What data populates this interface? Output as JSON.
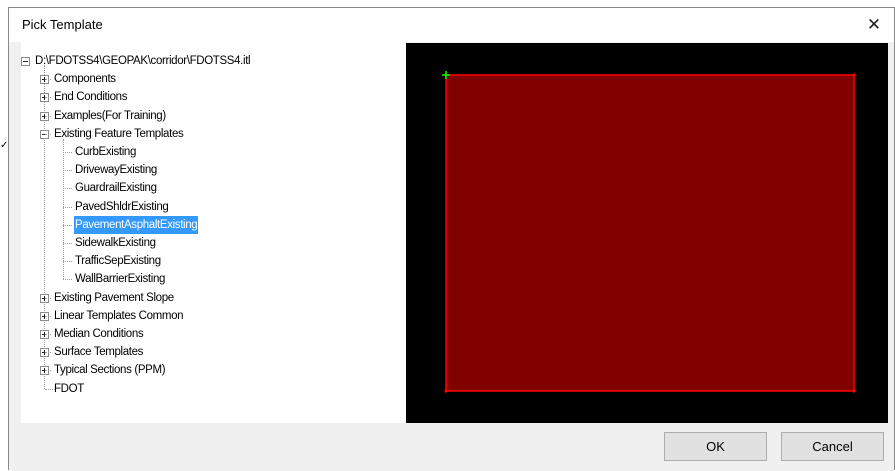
{
  "dialog": {
    "title": "Pick Template",
    "close_icon": "close-icon",
    "ok_label": "OK",
    "cancel_label": "Cancel"
  },
  "tree": {
    "root": "D:\\FDOTSS4\\GEOPAK\\corridor\\FDOTSS4.itl",
    "nodes": [
      {
        "label": "Components",
        "level": 1,
        "expander": "plus"
      },
      {
        "label": "End Conditions",
        "level": 1,
        "expander": "plus"
      },
      {
        "label": "Examples(For Training)",
        "level": 1,
        "expander": "plus"
      },
      {
        "label": "Existing Feature Templates",
        "level": 1,
        "expander": "minus"
      },
      {
        "label": "CurbExisting",
        "level": 2
      },
      {
        "label": "DrivewayExisting",
        "level": 2
      },
      {
        "label": "GuardrailExisting",
        "level": 2
      },
      {
        "label": "PavedShldrExisting",
        "level": 2
      },
      {
        "label": "PavementAsphaltExisting",
        "level": 2,
        "selected": true
      },
      {
        "label": "SidewalkExisting",
        "level": 2
      },
      {
        "label": "TrafficSepExisting",
        "level": 2
      },
      {
        "label": "WallBarrierExisting",
        "level": 2
      },
      {
        "label": "Existing Pavement Slope",
        "level": 1,
        "expander": "plus"
      },
      {
        "label": "Linear Templates Common",
        "level": 1,
        "expander": "plus"
      },
      {
        "label": "Median Conditions",
        "level": 1,
        "expander": "plus"
      },
      {
        "label": "Surface Templates",
        "level": 1,
        "expander": "plus"
      },
      {
        "label": "Typical Sections (PPM)",
        "level": 1,
        "expander": "plus"
      },
      {
        "label": "FDOT",
        "level": 1
      }
    ]
  },
  "preview": {
    "background": "#000000",
    "fill_color": "#800000",
    "outline_color": "#ff0000",
    "origin_marker_color": "#00ff00"
  },
  "colors": {
    "selection": "#3399ff",
    "dialog_bg": "#f0f0f0"
  }
}
